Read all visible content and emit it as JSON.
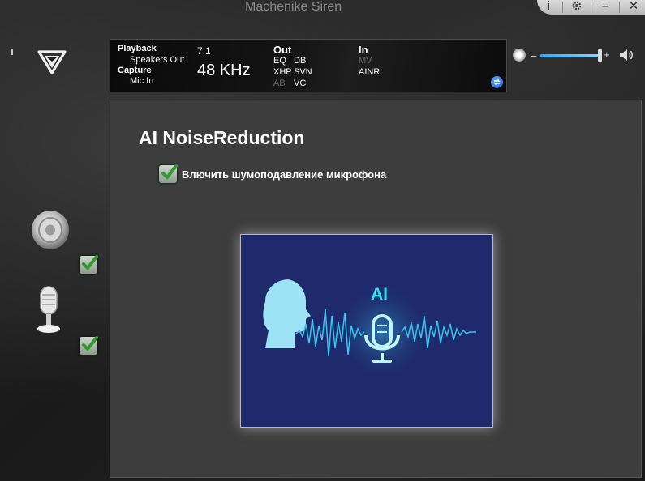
{
  "window": {
    "title": "Machenike Siren",
    "controls": {
      "info": "i",
      "settings": "gear",
      "minimize": "–",
      "close": "✕"
    }
  },
  "info_panel": {
    "playback_label": "Playback",
    "playback_device": "Speakers Out",
    "capture_label": "Capture",
    "capture_device": "Mic In",
    "channels": "7.1",
    "sample_rate": "48 KHz",
    "out_header": "Out",
    "out_items": [
      "EQ",
      "DB",
      "XHP",
      "SVN",
      "AB",
      "VC"
    ],
    "in_header": "In",
    "in_items": [
      "MV",
      "AINR"
    ]
  },
  "volume": {
    "minus": "–",
    "plus": "+",
    "level": 0.93
  },
  "main": {
    "heading": "AI NoiseReduction",
    "checkbox_label": "Влючить шумоподавление микрофона",
    "checkbox_checked": true,
    "image_ai_text": "AI"
  },
  "sidebar": {
    "speaker_checked": true,
    "mic_checked": true
  },
  "colors": {
    "accent_cyan": "#2ee3f4",
    "image_bg": "#1e2a6b",
    "volume_blue": "#2fa8ff",
    "panel_bg": "#3d3d3d"
  }
}
